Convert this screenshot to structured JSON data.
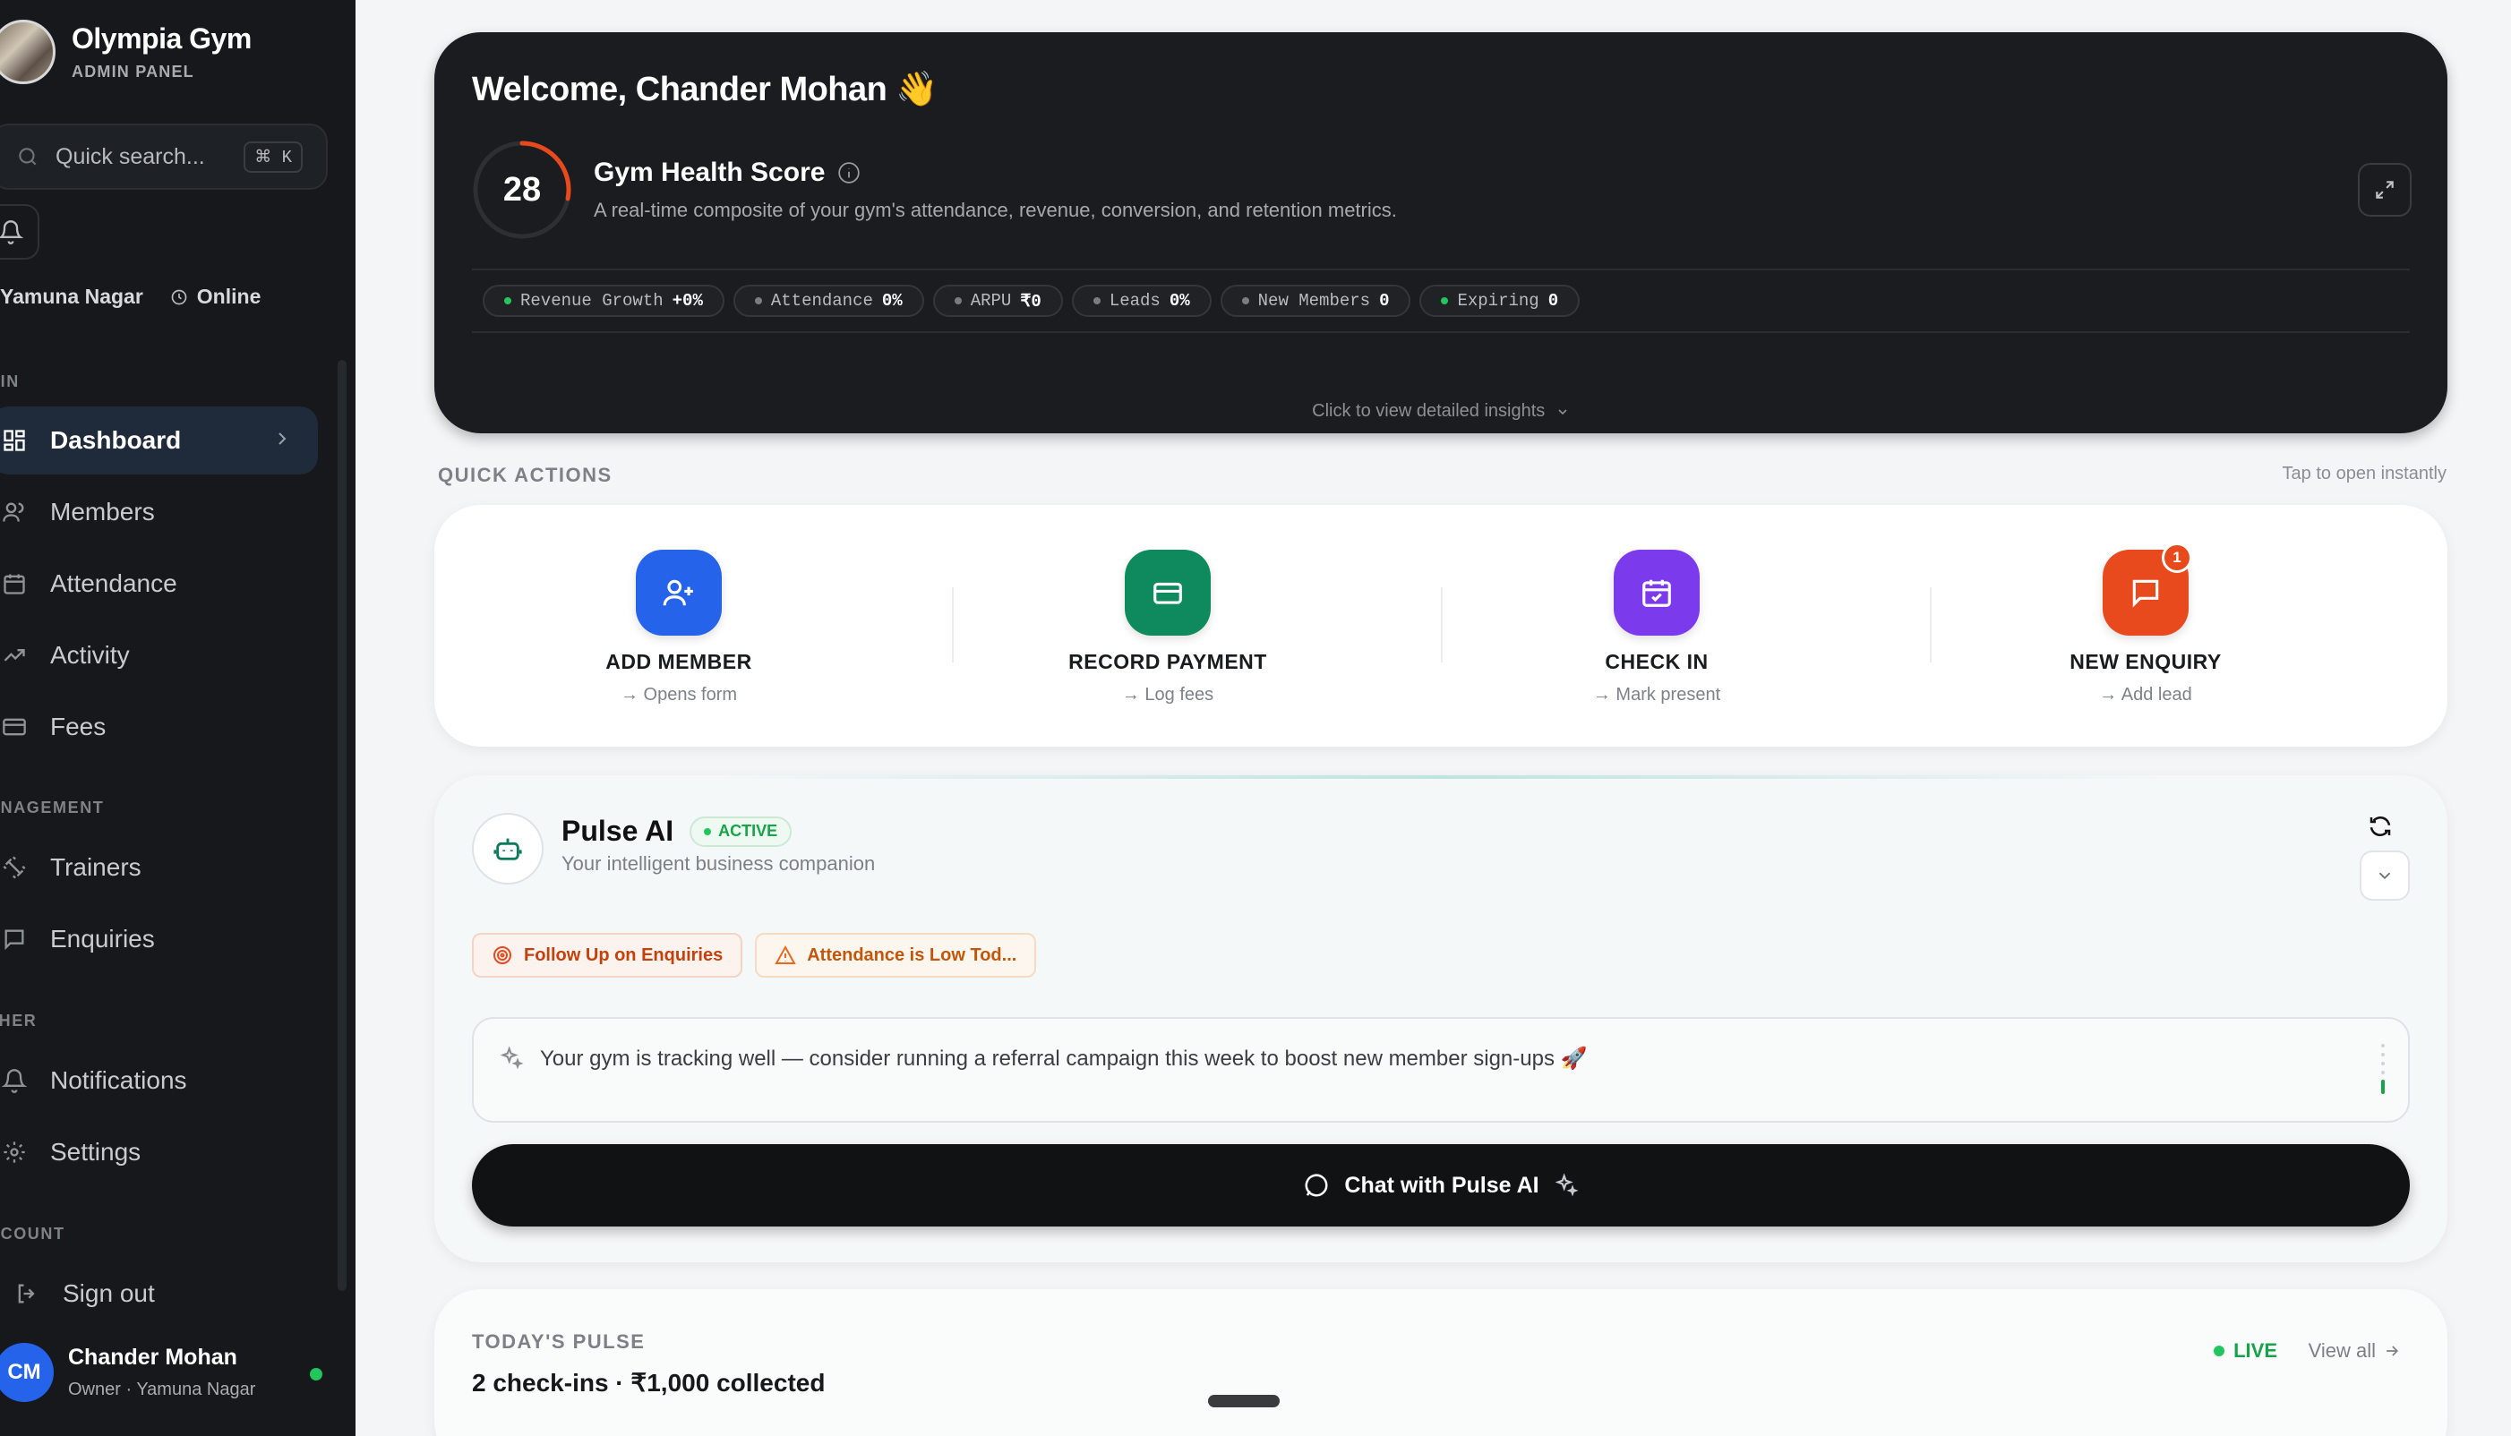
{
  "sidebar": {
    "brand_name": "Olympia Gym",
    "brand_sub": "ADMIN PANEL",
    "search_placeholder": "Quick search...",
    "search_shortcut": "⌘ K",
    "location": "Yamuna Nagar",
    "status": "Online",
    "sections": {
      "main": "AIN",
      "management": "ANAGEMENT",
      "other": "THER",
      "account": "CCOUNT"
    },
    "items": [
      {
        "label": "Dashboard",
        "icon": "grid-icon",
        "active": true
      },
      {
        "label": "Members",
        "icon": "users-icon"
      },
      {
        "label": "Attendance",
        "icon": "calendar-icon"
      },
      {
        "label": "Activity",
        "icon": "trend-icon"
      },
      {
        "label": "Fees",
        "icon": "card-icon"
      },
      {
        "label": "Trainers",
        "icon": "dumbbell-icon"
      },
      {
        "label": "Enquiries",
        "icon": "message-icon"
      },
      {
        "label": "Notifications",
        "icon": "bell-icon"
      },
      {
        "label": "Settings",
        "icon": "gear-icon"
      },
      {
        "label": "Sign out",
        "icon": "logout-icon"
      }
    ],
    "user": {
      "initials": "CM",
      "name": "Chander Mohan",
      "role": "Owner · Yamuna Nagar"
    }
  },
  "health": {
    "welcome": "Welcome, Chander Mohan 👋",
    "score": "28",
    "score_fraction": 0.28,
    "title": "Gym Health Score",
    "description": "A real-time composite of your gym's attendance, revenue, conversion, and retention metrics.",
    "metrics": [
      {
        "label": "Revenue Growth",
        "value": "+0%",
        "status": "green"
      },
      {
        "label": "Attendance",
        "value": "0%",
        "status": "gray"
      },
      {
        "label": "ARPU",
        "value": "₹0",
        "status": "gray"
      },
      {
        "label": "Leads",
        "value": "0%",
        "status": "gray"
      },
      {
        "label": "New Members",
        "value": "0",
        "status": "gray"
      },
      {
        "label": "Expiring",
        "value": "0",
        "status": "green"
      }
    ],
    "insights_link": "Click to view detailed insights"
  },
  "quick_actions": {
    "label": "QUICK ACTIONS",
    "hint": "Tap to open instantly",
    "items": [
      {
        "title": "ADD MEMBER",
        "sub": "→ Opens form",
        "color": "#2563eb",
        "icon": "user-plus-icon"
      },
      {
        "title": "RECORD PAYMENT",
        "sub": "→ Log fees",
        "color": "#0f8a5f",
        "icon": "credit-card-icon"
      },
      {
        "title": "CHECK IN",
        "sub": "→ Mark present",
        "color": "#7c3aed",
        "icon": "calendar-check-icon"
      },
      {
        "title": "NEW ENQUIRY",
        "sub": "→ Add lead",
        "color": "#e8491d",
        "icon": "message-icon",
        "badge": "1"
      }
    ]
  },
  "pulse_ai": {
    "name": "Pulse AI",
    "status": "ACTIVE",
    "subtitle": "Your intelligent business companion",
    "tags": [
      {
        "label": "Follow Up on Enquiries",
        "icon": "target-icon"
      },
      {
        "label": "Attendance is Low Tod...",
        "icon": "warning-icon"
      }
    ],
    "insight": "Your gym is tracking well — consider running a referral campaign this week to boost new member sign-ups 🚀",
    "chat_label": "Chat with Pulse AI"
  },
  "today": {
    "label": "TODAY'S PULSE",
    "summary": "2 check-ins · ₹1,000 collected",
    "live": "LIVE",
    "view_all": "View all"
  }
}
